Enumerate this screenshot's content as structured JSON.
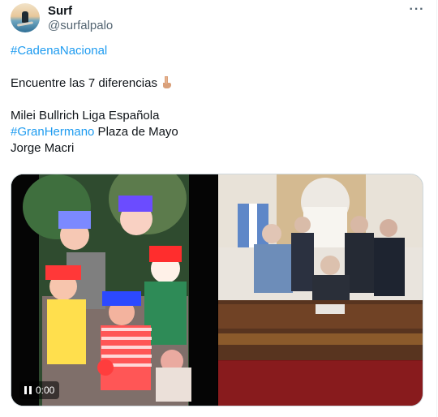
{
  "author": {
    "name": "Surf",
    "handle": "@surfalpalo"
  },
  "tweet": {
    "lines": [
      [
        {
          "text": "#CadenaNacional",
          "type": "hashtag"
        }
      ],
      [],
      [
        {
          "text": "Encuentre las 7 diferencias",
          "type": "text"
        }
      ],
      [],
      [
        {
          "text": "Milei Bullrich Liga Española",
          "type": "text"
        }
      ],
      [
        {
          "text": "#GranHermano",
          "type": "hashtag"
        },
        {
          "text": " Plaza de Mayo",
          "type": "text"
        }
      ],
      [
        {
          "text": "Jorge Macri",
          "type": "text"
        }
      ]
    ],
    "emoji": "finger-pointing-down-emoji"
  },
  "video": {
    "time": "0:00",
    "state": "paused-control",
    "left_panel": "clowns-photo",
    "right_panel": "government-announcement-photo"
  },
  "colors": {
    "hashtag": "#1d9bf0",
    "text": "#0f1419",
    "secondary": "#536471",
    "border": "#cfd9de"
  }
}
